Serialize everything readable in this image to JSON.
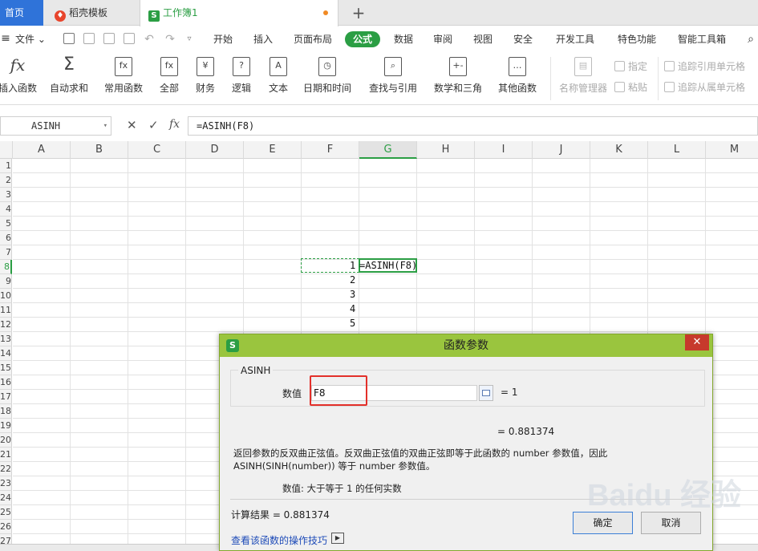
{
  "tabs": {
    "home": "首页",
    "template": "稻壳模板",
    "workbook": "工作簿1",
    "new_tab": "+"
  },
  "menubar": {
    "file": "文件",
    "items": [
      "开始",
      "插入",
      "页面布局",
      "公式",
      "数据",
      "审阅",
      "视图",
      "安全",
      "开发工具",
      "特色功能",
      "智能工具箱"
    ],
    "active": "公式"
  },
  "ribbon": {
    "buttons": [
      {
        "label": "插入函数",
        "icon": "fx"
      },
      {
        "label": "自动求和",
        "icon": "Σ"
      },
      {
        "label": "常用函数",
        "icon": "fx"
      },
      {
        "label": "全部",
        "icon": "fx"
      },
      {
        "label": "财务",
        "icon": "¥"
      },
      {
        "label": "逻辑",
        "icon": "?"
      },
      {
        "label": "文本",
        "icon": "A"
      },
      {
        "label": "日期和时间",
        "icon": "◷"
      },
      {
        "label": "查找与引用",
        "icon": "⌕"
      },
      {
        "label": "数学和三角",
        "icon": "+-"
      },
      {
        "label": "其他函数",
        "icon": "…"
      },
      {
        "label": "名称管理器",
        "icon": "▤"
      }
    ],
    "small": {
      "assign": "指定",
      "paste": "粘贴",
      "trace_precedents": "追踪引用单元格",
      "trace_dependents": "追踪从属单元格"
    }
  },
  "formula_bar": {
    "name_box": "ASINH",
    "fx_label": "fx",
    "formula": "=ASINH(F8)"
  },
  "grid": {
    "columns": [
      "A",
      "B",
      "C",
      "D",
      "E",
      "F",
      "G",
      "H",
      "I",
      "J",
      "K",
      "L",
      "M"
    ],
    "selected_column": "G",
    "row_labels": [
      "1",
      "2",
      "3",
      "4",
      "5",
      "6",
      "7",
      "8",
      "9",
      "10",
      "11",
      "12",
      "13",
      "14",
      "15",
      "16",
      "17",
      "18",
      "19",
      "20",
      "21",
      "22",
      "23",
      "24",
      "25",
      "26",
      "27"
    ],
    "f_values": [
      "1",
      "2",
      "3",
      "4",
      "5"
    ],
    "g8": "=ASINH(F8)"
  },
  "dialog": {
    "title": "函数参数",
    "close": "✕",
    "function_name": "ASINH",
    "param_label": "数值",
    "param_value": "F8",
    "param_eval": "=  1",
    "result_preview": "=  0.881374",
    "description_line1": "返回参数的反双曲正弦值。反双曲正弦值的双曲正弦即等于此函数的 number 参数值，因此",
    "description_line2": "ASINH(SINH(number)) 等于 number 参数值。",
    "param_desc": "数值:  大于等于 1 的任何实数",
    "calc_result": "计算结果  =  0.881374",
    "help_link": "查看该函数的操作技巧",
    "ok": "确定",
    "cancel": "取消"
  },
  "watermark": "Baidu 经验",
  "colors": {
    "accent": "#2b9e44",
    "dialog_title": "#9ac53e",
    "close": "#c7392c",
    "highlight": "#e3302a",
    "home_tab": "#2f73d9"
  }
}
